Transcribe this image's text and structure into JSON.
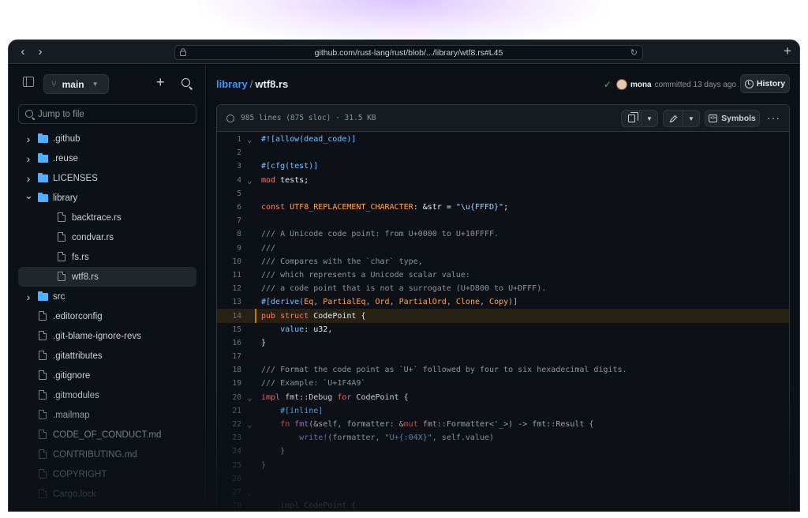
{
  "browser": {
    "url": "github.com/rust-lang/rust/blob/.../library/wtf8.rs#L45",
    "back": "‹",
    "forward": "›",
    "new_tab": "+",
    "reload": "↻"
  },
  "sidebar": {
    "branch": "main",
    "jump_placeholder": "Jump to file",
    "items": [
      {
        "label": ".github",
        "kind": "folder",
        "expanded": false
      },
      {
        "label": ".reuse",
        "kind": "folder",
        "expanded": false
      },
      {
        "label": "LICENSES",
        "kind": "folder",
        "expanded": false
      },
      {
        "label": "library",
        "kind": "folder",
        "expanded": true
      },
      {
        "label": "backtrace.rs",
        "kind": "file",
        "depth": 1
      },
      {
        "label": "condvar.rs",
        "kind": "file",
        "depth": 1
      },
      {
        "label": "fs.rs",
        "kind": "file",
        "depth": 1
      },
      {
        "label": "wtf8.rs",
        "kind": "file",
        "depth": 1,
        "selected": true
      },
      {
        "label": "src",
        "kind": "folder",
        "expanded": false
      },
      {
        "label": ".editorconfig",
        "kind": "file"
      },
      {
        "label": ".git-blame-ignore-revs",
        "kind": "file"
      },
      {
        "label": ".gitattributes",
        "kind": "file"
      },
      {
        "label": ".gitignore",
        "kind": "file"
      },
      {
        "label": ".gitmodules",
        "kind": "file"
      },
      {
        "label": ".mailmap",
        "kind": "file"
      },
      {
        "label": "CODE_OF_CONDUCT.md",
        "kind": "file"
      },
      {
        "label": "CONTRIBUTING.md",
        "kind": "file"
      },
      {
        "label": "COPYRIGHT",
        "kind": "file"
      },
      {
        "label": "Cargo.lock",
        "kind": "file"
      }
    ]
  },
  "header": {
    "crumb_folder": "library",
    "crumb_sep": "/",
    "crumb_file": "wtf8.rs",
    "commit_user": "mona",
    "commit_text": "committed 13 days ago",
    "history_label": "History"
  },
  "file": {
    "meta": "985 lines (875 sloc) · 31.5 KB",
    "symbols_label": "Symbols",
    "more": "···"
  },
  "code": [
    {
      "n": "1",
      "fold": true,
      "parts": [
        [
          "ent",
          "#![allow(dead_code)]"
        ]
      ]
    },
    {
      "n": "2",
      "parts": []
    },
    {
      "n": "3",
      "parts": [
        [
          "ent",
          "#[cfg(test)]"
        ]
      ]
    },
    {
      "n": "4",
      "fold": true,
      "parts": [
        [
          "kw",
          "mod"
        ],
        [
          "plain",
          " tests;"
        ]
      ]
    },
    {
      "n": "5",
      "parts": []
    },
    {
      "n": "6",
      "parts": [
        [
          "kw",
          "const"
        ],
        [
          "plain",
          " "
        ],
        [
          "ty",
          "UTF8_REPLACEMENT_CHARACTER"
        ],
        [
          "plain",
          ": &str = "
        ],
        [
          "str",
          "\"\\u{FFFD}\""
        ],
        [
          "plain",
          ";"
        ]
      ]
    },
    {
      "n": "7",
      "parts": []
    },
    {
      "n": "8",
      "parts": [
        [
          "com",
          "/// A Unicode code point: from U+0000 to U+10FFFF."
        ]
      ]
    },
    {
      "n": "9",
      "parts": [
        [
          "com",
          "///"
        ]
      ]
    },
    {
      "n": "10",
      "parts": [
        [
          "com",
          "/// Compares with the `char` type,"
        ]
      ]
    },
    {
      "n": "11",
      "parts": [
        [
          "com",
          "/// which represents a Unicode scalar value:"
        ]
      ]
    },
    {
      "n": "12",
      "parts": [
        [
          "com",
          "/// a code point that is not a surrogate (U+D800 to U+DFFF)."
        ]
      ]
    },
    {
      "n": "13",
      "parts": [
        [
          "ent",
          "#[derive("
        ],
        [
          "ty",
          "Eq"
        ],
        [
          "ent",
          ", "
        ],
        [
          "ty",
          "PartialEq"
        ],
        [
          "ent",
          ", "
        ],
        [
          "ty",
          "Ord"
        ],
        [
          "ent",
          ", "
        ],
        [
          "ty",
          "PartialOrd"
        ],
        [
          "ent",
          ", "
        ],
        [
          "ty",
          "Clone"
        ],
        [
          "ent",
          ", "
        ],
        [
          "ty",
          "Copy"
        ],
        [
          "ent",
          ")]"
        ]
      ]
    },
    {
      "n": "14",
      "hl": true,
      "parts": [
        [
          "kw",
          "pub struct"
        ],
        [
          "plain",
          " CodePoint {"
        ]
      ]
    },
    {
      "n": "15",
      "parts": [
        [
          "plain",
          "    "
        ],
        [
          "ent",
          "value"
        ],
        [
          "plain",
          ": u32,"
        ]
      ]
    },
    {
      "n": "16",
      "parts": [
        [
          "plain",
          "}"
        ]
      ]
    },
    {
      "n": "17",
      "parts": []
    },
    {
      "n": "18",
      "parts": [
        [
          "com",
          "/// Format the code point as `U+` followed by four to six hexadecimal digits."
        ]
      ]
    },
    {
      "n": "19",
      "parts": [
        [
          "com",
          "/// Example: `U+1F4A9`"
        ]
      ]
    },
    {
      "n": "20",
      "fold": true,
      "parts": [
        [
          "kw",
          "impl"
        ],
        [
          "plain",
          " fmt::Debug "
        ],
        [
          "kw",
          "for"
        ],
        [
          "plain",
          " CodePoint {"
        ]
      ]
    },
    {
      "n": "21",
      "parts": [
        [
          "plain",
          "    "
        ],
        [
          "ent",
          "#[inline]"
        ]
      ]
    },
    {
      "n": "22",
      "fold": true,
      "parts": [
        [
          "plain",
          "    "
        ],
        [
          "kw",
          "fn"
        ],
        [
          "plain",
          " "
        ],
        [
          "fn",
          "fmt"
        ],
        [
          "plain",
          "(&self, formatter: &"
        ],
        [
          "kw",
          "mut"
        ],
        [
          "plain",
          " fmt::Formatter<'_>) -> fmt::Result {"
        ]
      ]
    },
    {
      "n": "23",
      "parts": [
        [
          "plain",
          "        "
        ],
        [
          "fn",
          "write!"
        ],
        [
          "plain",
          "(formatter, "
        ],
        [
          "str",
          "\"U+{:04X}\""
        ],
        [
          "plain",
          ", self.value)"
        ]
      ]
    },
    {
      "n": "24",
      "parts": [
        [
          "plain",
          "    }"
        ]
      ]
    },
    {
      "n": "25",
      "parts": [
        [
          "plain",
          "}"
        ]
      ]
    },
    {
      "n": "26",
      "parts": []
    },
    {
      "n": "27",
      "fold": true,
      "parts": []
    },
    {
      "n": "28",
      "parts": [
        [
          "plain",
          "    "
        ],
        [
          "plain",
          "impl CodePoint {"
        ]
      ]
    }
  ]
}
